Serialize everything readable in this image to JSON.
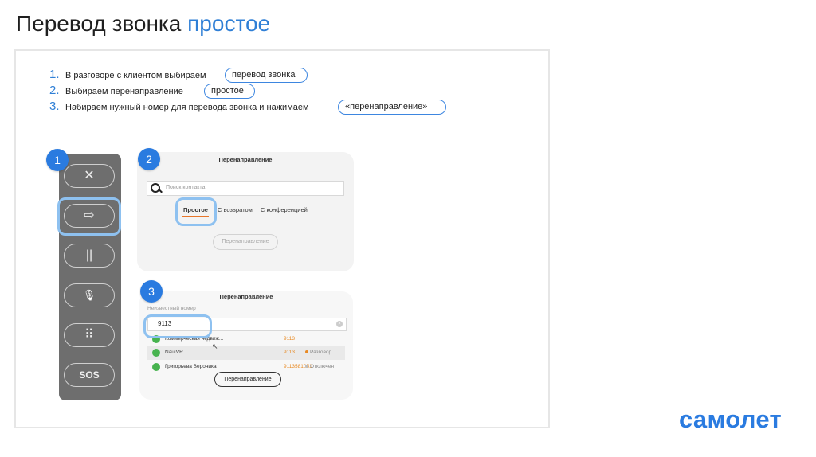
{
  "slide": {
    "title_main": "Перевод звонка",
    "title_accent": "простое",
    "logo": "самолет"
  },
  "steps": [
    {
      "num": "1.",
      "text": "В разговоре с клиентом выбираем",
      "highlight": "перевод звонка"
    },
    {
      "num": "2.",
      "text": "Выбираем перенаправление",
      "highlight": "простое"
    },
    {
      "num": "3.",
      "text": "Набираем нужный номер для перевода звонка и нажимаем",
      "highlight": "«перенаправление»"
    }
  ],
  "badges": [
    "1",
    "2",
    "3"
  ],
  "call_panel": {
    "buttons": [
      {
        "icon": "close-icon",
        "glyph": "✕"
      },
      {
        "icon": "transfer-arrow-icon",
        "glyph": "⇨"
      },
      {
        "icon": "pause-icon",
        "glyph": "||"
      },
      {
        "icon": "mute-mic-icon",
        "glyph": "🎙"
      },
      {
        "icon": "dialpad-icon",
        "glyph": "⠿"
      },
      {
        "icon": "sos-icon",
        "glyph": "SOS"
      }
    ]
  },
  "redirect_panel": {
    "title": "Перенаправление",
    "search_placeholder": "Поиск контакта",
    "tabs": [
      "Простое",
      "С возвратом",
      "С конференцией"
    ],
    "button": "Перенаправление"
  },
  "dial_panel": {
    "title": "Перенаправление",
    "subtitle": "Неизвестный номер",
    "input_value": "9113",
    "results": [
      {
        "name": "Коммерческая недвиж...",
        "phone": "9113",
        "status": ""
      },
      {
        "name": "NauIVR",
        "phone": "9113",
        "status": "Разговор"
      },
      {
        "name": "Григорьева Вероника",
        "phone": "9113581051",
        "status": "Отключен"
      }
    ],
    "button": "Перенаправление"
  },
  "colors": {
    "accent": "#2f7fd6",
    "logo": "#2a7be0",
    "status_talking": "#e88a24",
    "status_off": "#bdbdbd",
    "avatar": "#47b34f",
    "tab_underline": "#e8762a"
  }
}
